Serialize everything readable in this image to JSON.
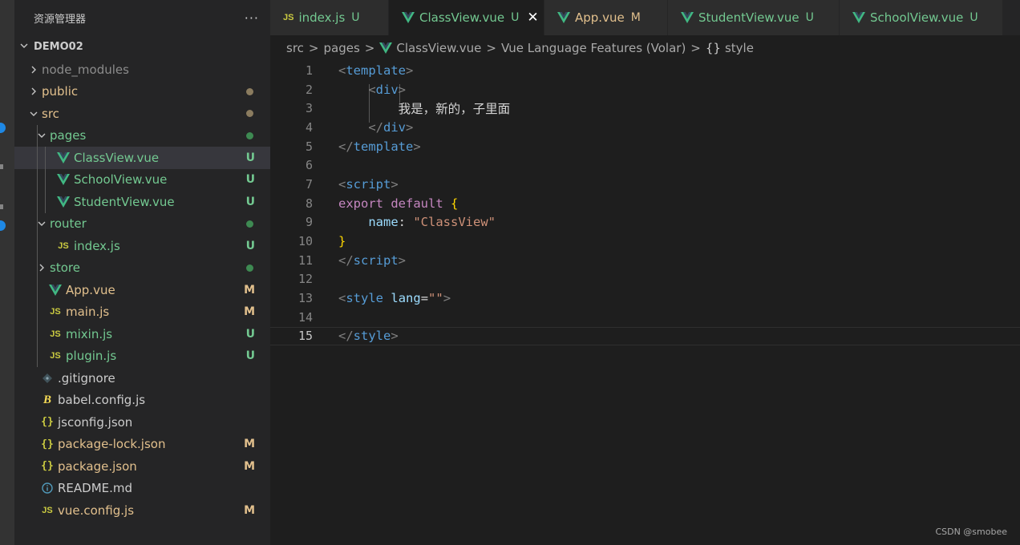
{
  "explorer": {
    "title": "资源管理器",
    "more": "···",
    "root": "DEMO02",
    "items": [
      {
        "label": "node_modules",
        "indent": 0,
        "chev": "right",
        "icon": "",
        "color": "#8c8c8c",
        "badge": "",
        "dot": ""
      },
      {
        "label": "public",
        "indent": 0,
        "chev": "right",
        "icon": "",
        "color": "#e2c08d",
        "badge": "",
        "dot": "#8b7c5f"
      },
      {
        "label": "src",
        "indent": 0,
        "chev": "down",
        "icon": "",
        "color": "#e2c08d",
        "badge": "",
        "dot": "#8b7c5f"
      },
      {
        "label": "pages",
        "indent": 1,
        "chev": "down",
        "icon": "",
        "color": "#73c991",
        "badge": "",
        "dot": "#3e8a52"
      },
      {
        "label": "ClassView.vue",
        "indent": 2,
        "chev": "",
        "icon": "vue",
        "color": "#73c991",
        "badge": "U",
        "badgeColor": "#73c991",
        "dot": "",
        "selected": true
      },
      {
        "label": "SchoolView.vue",
        "indent": 2,
        "chev": "",
        "icon": "vue",
        "color": "#73c991",
        "badge": "U",
        "badgeColor": "#73c991",
        "dot": ""
      },
      {
        "label": "StudentView.vue",
        "indent": 2,
        "chev": "",
        "icon": "vue",
        "color": "#73c991",
        "badge": "U",
        "badgeColor": "#73c991",
        "dot": ""
      },
      {
        "label": "router",
        "indent": 1,
        "chev": "down",
        "icon": "",
        "color": "#73c991",
        "badge": "",
        "dot": "#3e8a52"
      },
      {
        "label": "index.js",
        "indent": 2,
        "chev": "",
        "icon": "js",
        "color": "#73c991",
        "badge": "U",
        "badgeColor": "#73c991",
        "dot": ""
      },
      {
        "label": "store",
        "indent": 1,
        "chev": "right",
        "icon": "",
        "color": "#73c991",
        "badge": "",
        "dot": "#3e8a52"
      },
      {
        "label": "App.vue",
        "indent": 1,
        "chev": "",
        "icon": "vue",
        "color": "#e2c08d",
        "badge": "M",
        "badgeColor": "#e2c08d",
        "dot": ""
      },
      {
        "label": "main.js",
        "indent": 1,
        "chev": "",
        "icon": "js",
        "color": "#e2c08d",
        "badge": "M",
        "badgeColor": "#e2c08d",
        "dot": ""
      },
      {
        "label": "mixin.js",
        "indent": 1,
        "chev": "",
        "icon": "js",
        "color": "#73c991",
        "badge": "U",
        "badgeColor": "#73c991",
        "dot": ""
      },
      {
        "label": "plugin.js",
        "indent": 1,
        "chev": "",
        "icon": "js",
        "color": "#73c991",
        "badge": "U",
        "badgeColor": "#73c991",
        "dot": ""
      },
      {
        "label": ".gitignore",
        "indent": 0,
        "chev": "",
        "icon": "git",
        "color": "#cccccc",
        "badge": "",
        "dot": ""
      },
      {
        "label": "babel.config.js",
        "indent": 0,
        "chev": "",
        "icon": "babel",
        "color": "#cccccc",
        "badge": "",
        "dot": ""
      },
      {
        "label": "jsconfig.json",
        "indent": 0,
        "chev": "",
        "icon": "json",
        "color": "#cccccc",
        "badge": "",
        "dot": ""
      },
      {
        "label": "package-lock.json",
        "indent": 0,
        "chev": "",
        "icon": "json",
        "color": "#e2c08d",
        "badge": "M",
        "badgeColor": "#e2c08d",
        "dot": ""
      },
      {
        "label": "package.json",
        "indent": 0,
        "chev": "",
        "icon": "json",
        "color": "#e2c08d",
        "badge": "M",
        "badgeColor": "#e2c08d",
        "dot": ""
      },
      {
        "label": "README.md",
        "indent": 0,
        "chev": "",
        "icon": "info",
        "color": "#cccccc",
        "badge": "",
        "dot": ""
      },
      {
        "label": "vue.config.js",
        "indent": 0,
        "chev": "",
        "icon": "js",
        "color": "#e2c08d",
        "badge": "M",
        "badgeColor": "#e2c08d",
        "dot": ""
      }
    ]
  },
  "tabs": [
    {
      "name": "index.js",
      "icon": "js",
      "color": "#73c991",
      "status": "U",
      "active": false,
      "close": ""
    },
    {
      "name": "ClassView.vue",
      "icon": "vue",
      "color": "#73c991",
      "status": "U",
      "active": true,
      "close": "✕"
    },
    {
      "name": "App.vue",
      "icon": "vue",
      "color": "#e2c08d",
      "status": "M",
      "active": false,
      "close": ""
    },
    {
      "name": "StudentView.vue",
      "icon": "vue",
      "color": "#73c991",
      "status": "U",
      "active": false,
      "close": ""
    },
    {
      "name": "SchoolView.vue",
      "icon": "vue",
      "color": "#73c991",
      "status": "U",
      "active": false,
      "close": ""
    }
  ],
  "breadcrumb": {
    "src": "src",
    "pages": "pages",
    "file": "ClassView.vue",
    "features": "Vue Language Features (Volar)",
    "style_icon": "{}",
    "style": "style",
    "sep": ">"
  },
  "code": {
    "current_line": 15,
    "lines": [
      [
        [
          "t-br",
          "<"
        ],
        [
          "t-tag",
          "template"
        ],
        [
          "t-br",
          ">"
        ]
      ],
      [
        [
          "",
          "    "
        ],
        [
          "t-br",
          "<"
        ],
        [
          "t-tag",
          "div"
        ],
        [
          "t-br",
          ">"
        ]
      ],
      [
        [
          "",
          "        我是，新的，子里面"
        ]
      ],
      [
        [
          "",
          "    "
        ],
        [
          "t-br",
          "</"
        ],
        [
          "t-tag",
          "div"
        ],
        [
          "t-br",
          ">"
        ]
      ],
      [
        [
          "t-br",
          "</"
        ],
        [
          "t-tag",
          "template"
        ],
        [
          "t-br",
          ">"
        ]
      ],
      [],
      [
        [
          "t-br",
          "<"
        ],
        [
          "t-tag",
          "script"
        ],
        [
          "t-br",
          ">"
        ]
      ],
      [
        [
          "t-kw",
          "export"
        ],
        [
          "",
          " "
        ],
        [
          "t-kw",
          "default"
        ],
        [
          "",
          " "
        ],
        [
          "t-brace",
          "{"
        ]
      ],
      [
        [
          "",
          "    "
        ],
        [
          "t-prop",
          "name"
        ],
        [
          "",
          ": "
        ],
        [
          "t-str",
          "\"ClassView\""
        ]
      ],
      [
        [
          "t-brace",
          "}"
        ]
      ],
      [
        [
          "t-br",
          "</"
        ],
        [
          "t-tag",
          "script"
        ],
        [
          "t-br",
          ">"
        ]
      ],
      [],
      [
        [
          "t-br",
          "<"
        ],
        [
          "t-tag",
          "style"
        ],
        [
          "",
          " "
        ],
        [
          "t-attr",
          "lang"
        ],
        [
          "",
          "="
        ],
        [
          "t-str",
          "\"\""
        ],
        [
          "t-br",
          ">"
        ]
      ],
      [],
      [
        [
          "t-br",
          "</"
        ],
        [
          "t-tag",
          "style"
        ],
        [
          "t-br",
          ">"
        ]
      ]
    ]
  },
  "watermark": "CSDN @smobee",
  "colors": {
    "vue_icon": "#41b883",
    "js_icon": "#cbcb41",
    "json_icon": "#cbcb41",
    "info_icon": "#519aba",
    "git_icon": "#41535b"
  }
}
